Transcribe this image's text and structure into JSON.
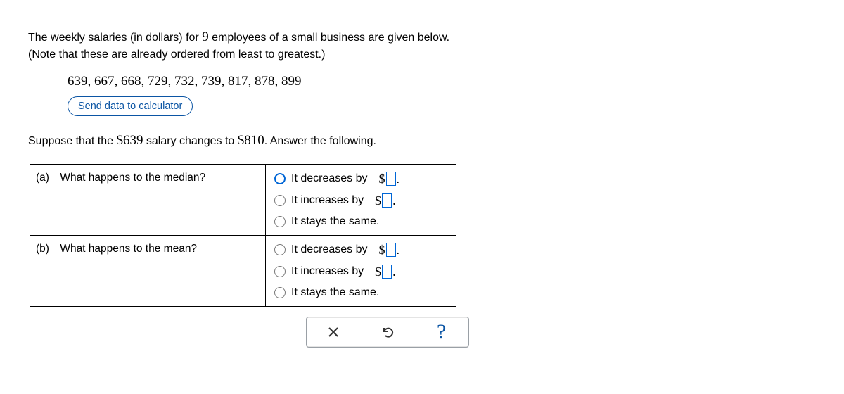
{
  "intro": {
    "p1_a": "The weekly salaries (in dollars) for ",
    "p1_n": "9",
    "p1_b": " employees of a small business are given below.",
    "p2": "(Note that these are already ordered from least to greatest.)"
  },
  "data_list": "639, 667, 668, 729, 732, 739, 817, 878, 899",
  "send_label": "Send data to calculator",
  "suppose": {
    "a": "Suppose that the ",
    "v1": "$639",
    "b": " salary changes to ",
    "v2": "$810",
    "c": ". Answer the following."
  },
  "parts": {
    "a": {
      "label": "(a)",
      "q": "What happens to the median?"
    },
    "b": {
      "label": "(b)",
      "q": "What happens to the mean?"
    }
  },
  "options": {
    "dec": "It decreases by",
    "inc": "It increases by",
    "same": "It stays the same."
  },
  "currency": "$",
  "period": ".",
  "actions": {
    "help": "?"
  }
}
